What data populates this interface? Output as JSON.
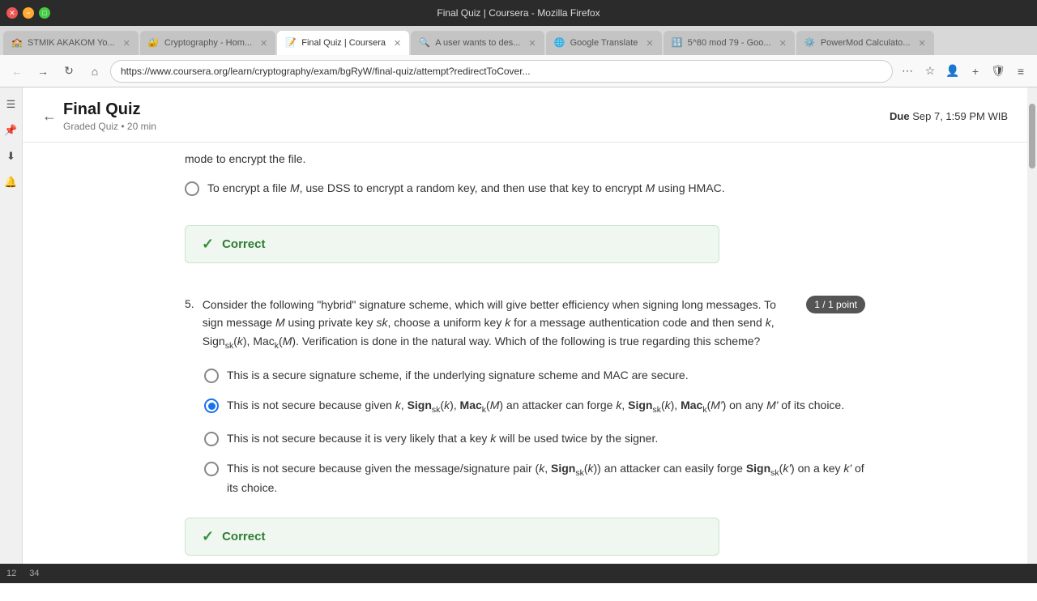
{
  "browser": {
    "title": "Final Quiz | Coursera - Mozilla Firefox",
    "tabs": [
      {
        "id": "tab1",
        "label": "STMIK AKAKOM Yo...",
        "active": false,
        "favicon": "🏫"
      },
      {
        "id": "tab2",
        "label": "Cryptography - Hom...",
        "active": false,
        "favicon": "🔐"
      },
      {
        "id": "tab3",
        "label": "Final Quiz | Coursera",
        "active": true,
        "favicon": "📝"
      },
      {
        "id": "tab4",
        "label": "A user wants to des...",
        "active": false,
        "favicon": "🔍"
      },
      {
        "id": "tab5",
        "label": "Google Translate",
        "active": false,
        "favicon": "🌐"
      },
      {
        "id": "tab6",
        "label": "5^80 mod 79 - Goo...",
        "active": false,
        "favicon": "🔢"
      },
      {
        "id": "tab7",
        "label": "PowerMod Calculato...",
        "active": false,
        "favicon": "⚙️"
      }
    ],
    "url": "https://www.coursera.org/learn/cryptography/exam/bgRyW/final-quiz/attempt?redirectToCover..."
  },
  "page": {
    "back_label": "",
    "title": "Final Quiz",
    "subtitle": "Graded Quiz • 20 min",
    "due_label": "Due",
    "due_date": "Sep 7, 1:59 PM WIB"
  },
  "partial_answer": {
    "text": "mode to encrypt the file.",
    "options": [
      {
        "id": "opt_dss",
        "text": "To encrypt a file M, use DSS to encrypt a random key, and then use that key to encrypt M using HMAC.",
        "selected": false
      }
    ]
  },
  "correct_banner_1": {
    "icon": "✓",
    "text": "Correct"
  },
  "question5": {
    "number": "5.",
    "text": "Consider the following \"hybrid\" signature scheme, which will give better efficiency when signing long messages. To sign message M using private key sk, choose a uniform key k for a message authentication code and then send k, Sign_sk(k), Mac_k(M). Verification is done in the natural way. Which of the following is true regarding this scheme?",
    "point_badge": "1 / 1 point",
    "options": [
      {
        "id": "q5_opt1",
        "text": "This is a secure signature scheme, if the underlying signature scheme and MAC are secure.",
        "selected": false
      },
      {
        "id": "q5_opt2",
        "text": "This is not secure because given k, Sign_sk(k), Mac_k(M) an attacker can forge k, Sign_sk(k), Mac_k(M') on any M' of its choice.",
        "selected": true
      },
      {
        "id": "q5_opt3",
        "text": "This is not secure because it is very likely that a key k will be used twice by the signer.",
        "selected": false
      },
      {
        "id": "q5_opt4",
        "text": "This is not secure because given the message/signature pair (k, Sign_sk(k)) an attacker can easily forge Sign_sk(k') on a key k' of its choice.",
        "selected": false
      }
    ]
  },
  "correct_banner_2": {
    "icon": "✓",
    "text": "Correct"
  }
}
